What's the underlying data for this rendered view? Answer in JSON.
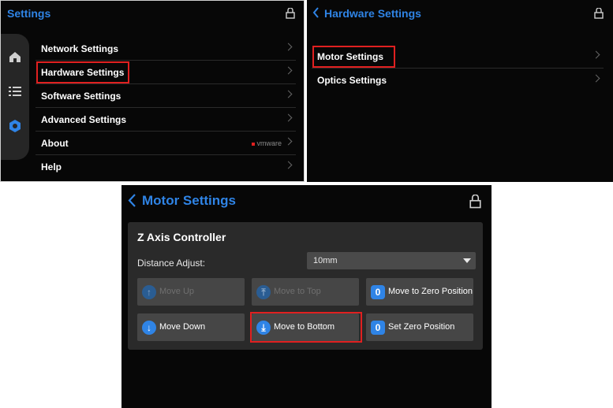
{
  "panel1": {
    "title": "Settings",
    "menu": [
      {
        "label": "Network Settings"
      },
      {
        "label": "Hardware Settings"
      },
      {
        "label": "Software Settings"
      },
      {
        "label": "Advanced Settings"
      },
      {
        "label": "About",
        "badge": "vmware"
      },
      {
        "label": "Help"
      }
    ],
    "highlight_color": "#e02020"
  },
  "panel2": {
    "title": "Hardware Settings",
    "menu": [
      {
        "label": "Motor Settings"
      },
      {
        "label": "Optics Settings"
      }
    ]
  },
  "panel3": {
    "title": "Motor Settings",
    "card_title": "Z Axis Controller",
    "distance_label": "Distance Adjust:",
    "distance_value": "10mm",
    "buttons": {
      "move_up": "Move Up",
      "move_to_top": "Move to Top",
      "move_to_zero": "Move to Zero Position",
      "move_down": "Move Down",
      "move_to_bottom": "Move to Bottom",
      "set_zero": "Set Zero Position"
    }
  },
  "colors": {
    "accent": "#2f84e6",
    "background": "#070707",
    "card": "#2a2a2a",
    "button": "#464646"
  }
}
